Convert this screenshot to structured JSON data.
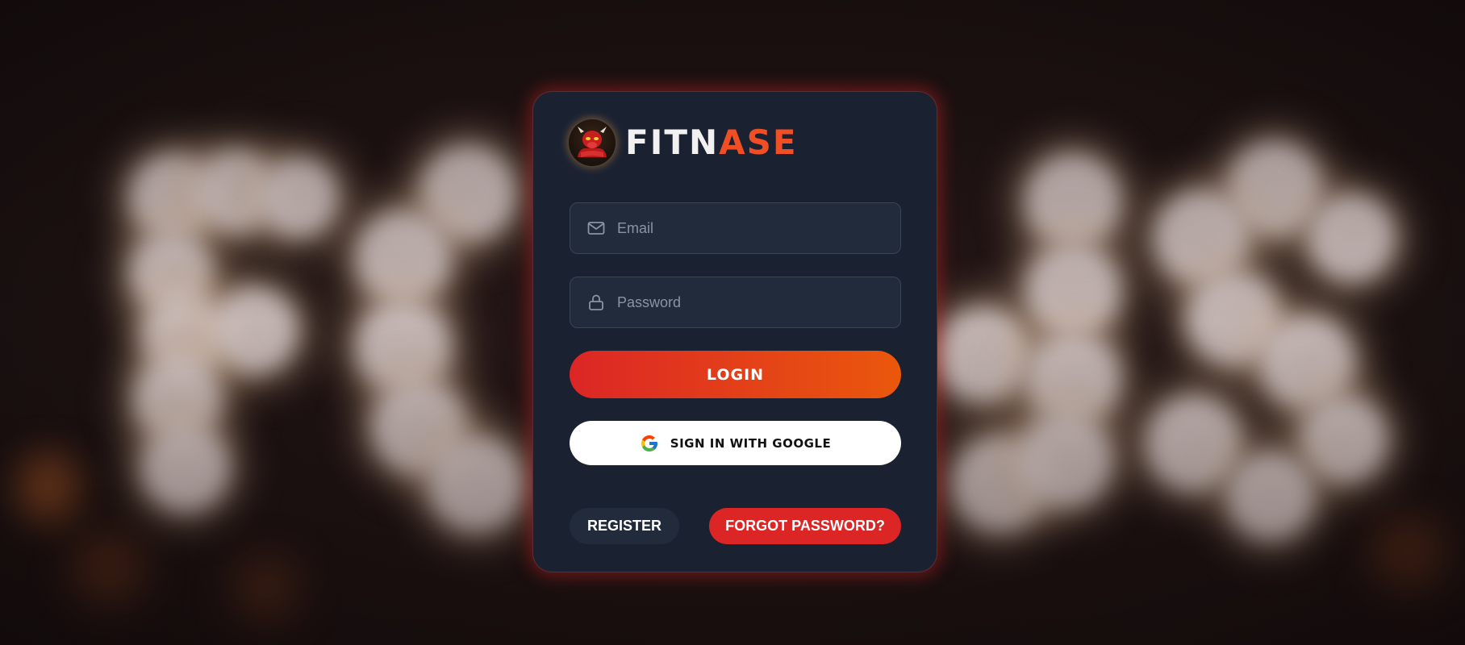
{
  "brand": {
    "name_part1": "FITN",
    "name_part2": "ASE",
    "logo_icon": "bull-mascot-icon"
  },
  "form": {
    "email_placeholder": "Email",
    "email_value": "",
    "email_icon": "mail-icon",
    "password_placeholder": "Password",
    "password_value": "",
    "password_icon": "lock-icon"
  },
  "buttons": {
    "login_label": "LOGIN",
    "google_label": "SIGN IN WITH GOOGLE",
    "register_label": "REGISTER",
    "forgot_label": "FORGOT PASSWORD?"
  },
  "colors": {
    "card_bg": "#1a2232",
    "accent_red": "#dc2626",
    "accent_orange": "#ea580c",
    "brand_orange": "#f04e25"
  }
}
